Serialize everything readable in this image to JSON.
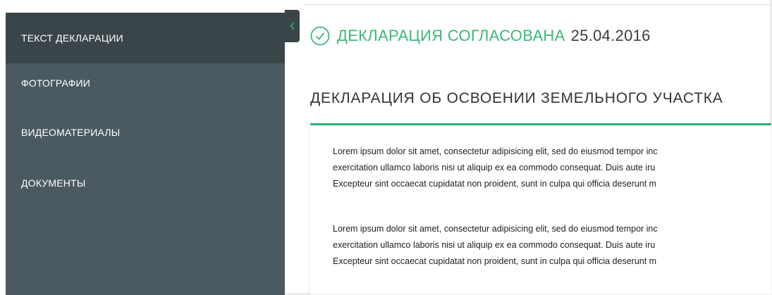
{
  "sidebar": {
    "items": [
      {
        "label": "ТЕКСТ ДЕКЛАРАЦИИ",
        "active": true
      },
      {
        "label": "ФОТОГРАФИИ",
        "active": false
      },
      {
        "label": "ВИДЕОМАТЕРИАЛЫ",
        "active": false
      },
      {
        "label": "ДОКУМЕНТЫ",
        "active": false
      }
    ],
    "collapse_icon": "chevron-left-icon"
  },
  "status": {
    "icon": "check-circle-icon",
    "text": "ДЕКЛАРАЦИЯ СОГЛАСОВАНА",
    "date": "25.04.2016"
  },
  "document": {
    "title": "ДЕКЛАРАЦИЯ ОБ ОСВОЕНИИ ЗЕМЕЛЬНОГО УЧАСТКА",
    "paragraphs": [
      {
        "lines": [
          "Lorem ipsum dolor sit amet, consectetur adipisicing elit, sed do eiusmod tempor inc",
          "exercitation ullamco laboris nisi ut aliquip ex ea commodo consequat. Duis aute iru",
          "Excepteur sint occaecat cupidatat non proident, sunt in culpa qui officia deserunt m"
        ]
      },
      {
        "lines": [
          "Lorem ipsum dolor sit amet, consectetur adipisicing elit, sed do eiusmod tempor inc",
          "exercitation ullamco laboris nisi ut aliquip ex ea commodo consequat. Duis aute iru",
          "Excepteur sint occaecat cupidatat non proident, sunt in culpa qui officia deserunt m"
        ]
      }
    ]
  },
  "colors": {
    "sidebar_bg": "#4b5a60",
    "sidebar_active_bg": "#3a4549",
    "accent_green": "#3cb878"
  }
}
